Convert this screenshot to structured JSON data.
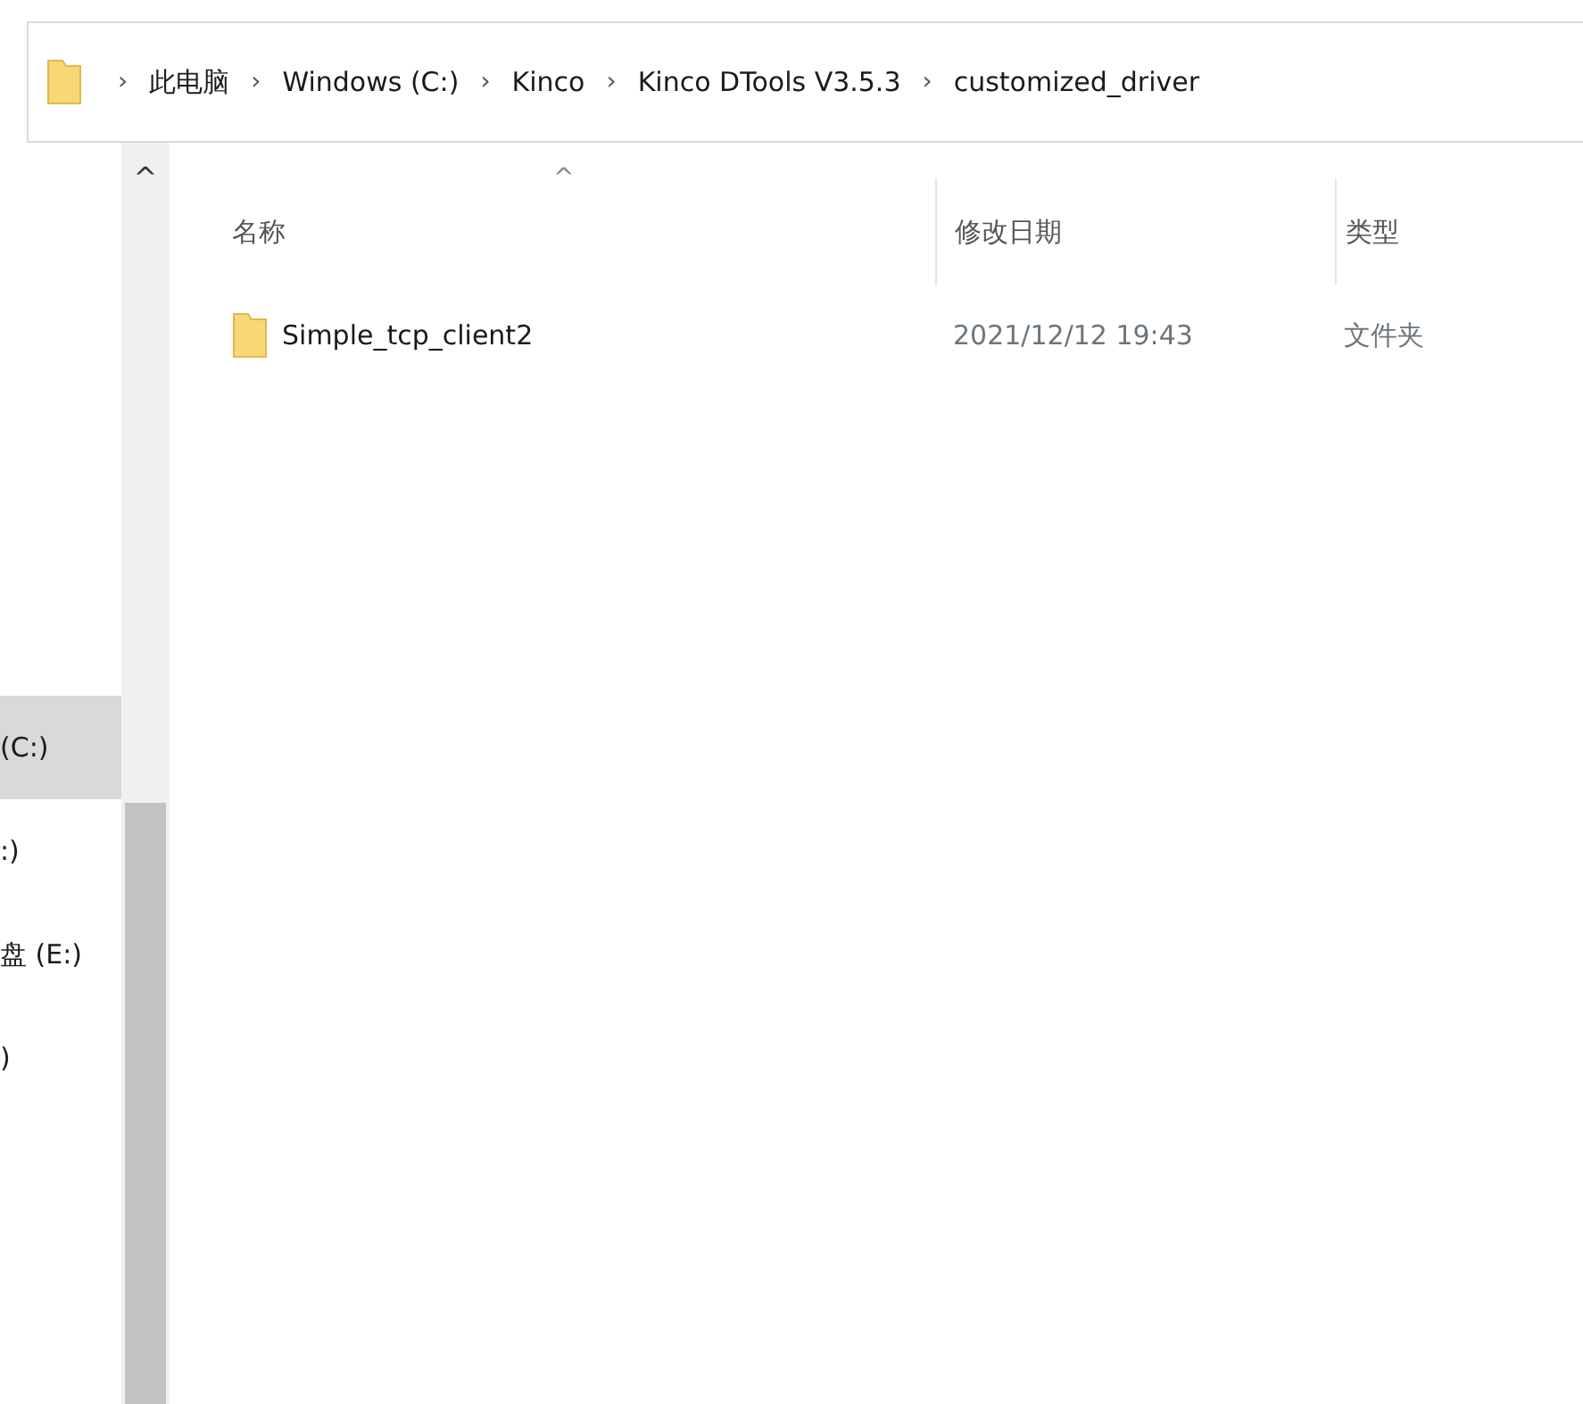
{
  "address_bar": {
    "separator": "›",
    "crumbs": [
      "此电脑",
      "Windows (C:)",
      "Kinco",
      "Kinco DTools V3.5.3",
      "customized_driver"
    ]
  },
  "sidebar": {
    "scroll_up": "^",
    "items": [
      {
        "label": "(C:)",
        "selected": true
      },
      {
        "label": ":)",
        "selected": false
      },
      {
        "label": "盘 (E:)",
        "selected": false
      },
      {
        "label": ")",
        "selected": false
      }
    ]
  },
  "table": {
    "sort_indicator": "^",
    "columns": [
      "名称",
      "修改日期",
      "类型"
    ],
    "rows": [
      {
        "name": "Simple_tcp_client2",
        "modified": "2021/12/12 19:43",
        "type": "文件夹"
      }
    ]
  }
}
